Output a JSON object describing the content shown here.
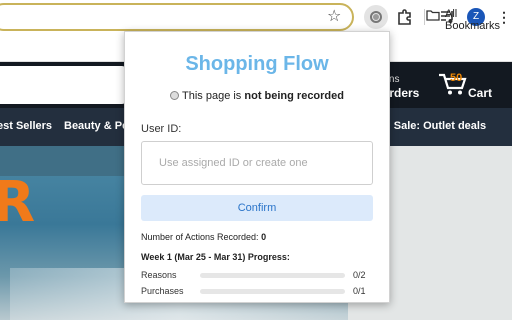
{
  "browser": {
    "bookmarks_label": "All Bookmarks",
    "avatar_letter": "Z",
    "star_glyph": "☆",
    "kebab_glyph": "⋮"
  },
  "site": {
    "returns_text": "urns",
    "orders_text": "Orders",
    "cart_count": "50",
    "cart_label": "Cart",
    "subnav": [
      "est Sellers",
      "Beauty & Pe",
      "g Sale: Outlet deals"
    ],
    "hero_letter": "R"
  },
  "popup": {
    "title": "Shopping Flow",
    "status_prefix": "This page is ",
    "status_bold": "not being recorded",
    "userid_label": "User ID:",
    "userid_placeholder": "Use assigned ID or create one",
    "confirm_label": "Confirm",
    "actions_label": "Number of Actions Recorded: ",
    "actions_count": "0",
    "week_title": "Week 1 (Mar 25 - Mar 31) Progress:",
    "progress": [
      {
        "label": "Reasons",
        "count": "0/2",
        "fraction": 0
      },
      {
        "label": "Purchases",
        "count": "0/1",
        "fraction": 0
      }
    ]
  },
  "colors": {
    "accent": "#6bb6e8",
    "confirm_bg": "#dceafb",
    "confirm_text": "#2a74c9",
    "omnibox_border": "#c9b35a",
    "site_nav": "#131921",
    "site_subnav": "#232f3e",
    "cart_orange": "#f08804"
  },
  "icons": [
    "star-icon",
    "extension-record-icon",
    "puzzle-icon",
    "media-control-icon",
    "profile-avatar",
    "more-menu-icon",
    "folder-icon",
    "cart-icon",
    "record-status-icon"
  ]
}
